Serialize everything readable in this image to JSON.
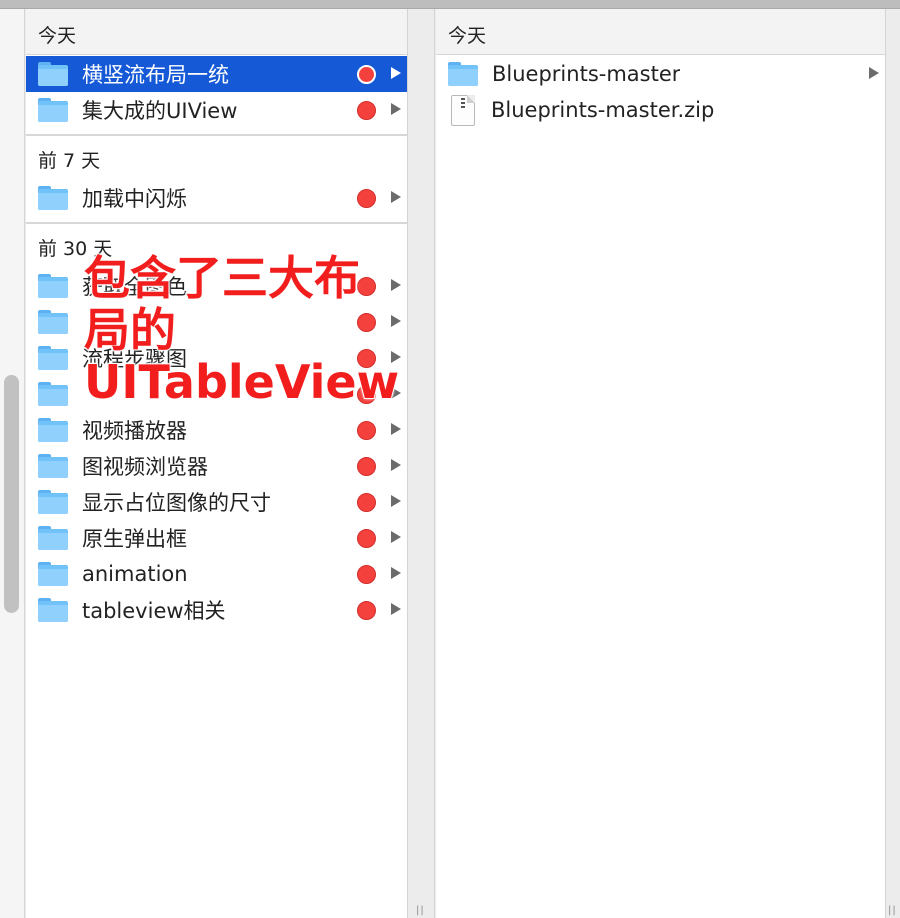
{
  "left_column": {
    "sections": [
      {
        "header": "今天",
        "items": [
          {
            "label": "横竖流布局一统",
            "selected": true,
            "tag_color": "#f5413e"
          },
          {
            "label": "集大成的UIView",
            "selected": false,
            "tag_color": "#f5413e"
          }
        ]
      },
      {
        "header": "前 7 天",
        "items": [
          {
            "label": "加载中闪烁",
            "selected": false,
            "tag_color": "#f5413e"
          }
        ]
      },
      {
        "header": "前 30 天",
        "items": [
          {
            "label": "获取全图色",
            "selected": false,
            "tag_color": "#f5413e"
          },
          {
            "label": "",
            "selected": false,
            "tag_color": "#f5413e"
          },
          {
            "label": "流程步骤图",
            "selected": false,
            "tag_color": "#f5413e"
          },
          {
            "label": "",
            "selected": false,
            "tag_color": "#f5413e"
          },
          {
            "label": "视频播放器",
            "selected": false,
            "tag_color": "#f5413e"
          },
          {
            "label": "图视频浏览器",
            "selected": false,
            "tag_color": "#f5413e"
          },
          {
            "label": "显示占位图像的尺寸",
            "selected": false,
            "tag_color": "#f5413e"
          },
          {
            "label": "原生弹出框",
            "selected": false,
            "tag_color": "#f5413e"
          },
          {
            "label": "animation",
            "selected": false,
            "tag_color": "#f5413e"
          },
          {
            "label": "tableview相关",
            "selected": false,
            "tag_color": "#f5413e"
          }
        ]
      }
    ]
  },
  "right_column": {
    "header": "今天",
    "items": [
      {
        "label": "Blueprints-master",
        "kind": "folder-icon"
      },
      {
        "label": "Blueprints-master.zip",
        "kind": "zip-file-icon"
      }
    ]
  },
  "overlay": {
    "lines": [
      "包含了三大布",
      "局的",
      "UITableView"
    ],
    "color": "#f21d1d"
  },
  "colors": {
    "selection": "#1559d6",
    "tag_red": "#f5413e",
    "folder_blue": "#72c2fa"
  }
}
